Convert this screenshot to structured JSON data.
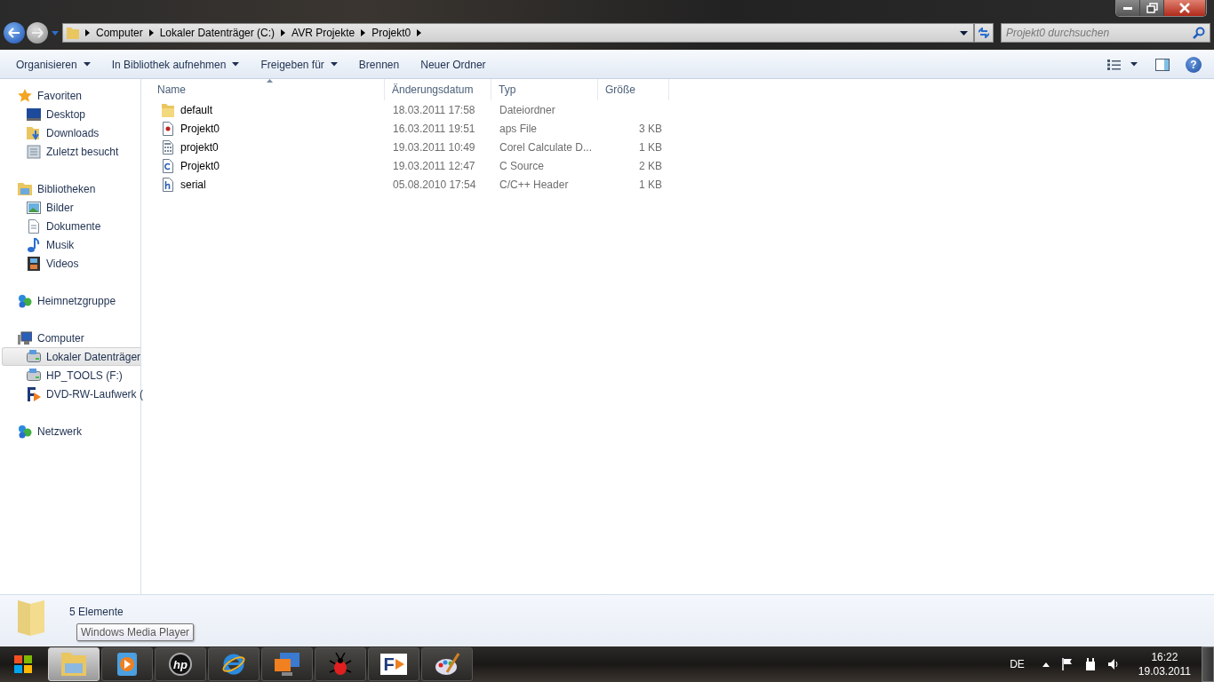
{
  "address_bar": {
    "crumbs": [
      "Computer",
      "Lokaler Datenträger (C:)",
      "AVR Projekte",
      "Projekt0"
    ]
  },
  "search": {
    "placeholder": "Projekt0 durchsuchen"
  },
  "toolbar": {
    "buttons": [
      {
        "label": "Organisieren",
        "dropdown": true
      },
      {
        "label": "In Bibliothek aufnehmen",
        "dropdown": true
      },
      {
        "label": "Freigeben für",
        "dropdown": true
      },
      {
        "label": "Brennen",
        "dropdown": false
      },
      {
        "label": "Neuer Ordner",
        "dropdown": false
      }
    ],
    "help": "?"
  },
  "sidebar": {
    "groups": [
      {
        "label": "Favoriten",
        "kind": "star",
        "children": [
          {
            "label": "Desktop",
            "kind": "desktop",
            "selected": false
          },
          {
            "label": "Downloads",
            "kind": "download",
            "selected": false
          },
          {
            "label": "Zuletzt besucht",
            "kind": "recent",
            "selected": false
          }
        ]
      },
      {
        "label": "Bibliotheken",
        "kind": "library",
        "children": [
          {
            "label": "Bilder",
            "kind": "picture",
            "selected": false
          },
          {
            "label": "Dokumente",
            "kind": "doc",
            "selected": false
          },
          {
            "label": "Musik",
            "kind": "music",
            "selected": false
          },
          {
            "label": "Videos",
            "kind": "film",
            "selected": false
          }
        ]
      },
      {
        "label": "Heimnetzgruppe",
        "kind": "network"
      },
      {
        "label": "Computer",
        "kind": "computer",
        "children": [
          {
            "label": "Lokaler Datenträger",
            "kind": "drive",
            "selected": true
          },
          {
            "label": "HP_TOOLS (F:)",
            "kind": "drive",
            "selected": false
          },
          {
            "label": "DVD-RW-Laufwerk (",
            "kind": "fdrive",
            "selected": false
          }
        ]
      },
      {
        "label": "Netzwerk",
        "kind": "network"
      }
    ]
  },
  "table": {
    "columns": [
      "Name",
      "Änderungsdatum",
      "Typ",
      "Größe"
    ],
    "rows": [
      {
        "kind": "folder",
        "name": "default",
        "date": "18.03.2011 17:58",
        "type": "Dateiordner",
        "size": ""
      },
      {
        "kind": "aps",
        "name": "Projekt0",
        "date": "16.03.2011 19:51",
        "type": "aps File",
        "size": "3 KB"
      },
      {
        "kind": "calc",
        "name": "projekt0",
        "date": "19.03.2011 10:49",
        "type": "Corel Calculate D...",
        "size": "1 KB"
      },
      {
        "kind": "c",
        "name": "Projekt0",
        "date": "19.03.2011 12:47",
        "type": "C Source",
        "size": "2 KB"
      },
      {
        "kind": "h",
        "name": "serial",
        "date": "05.08.2010 17:54",
        "type": "C/C++ Header",
        "size": "1 KB"
      }
    ]
  },
  "status_bar": {
    "count": "5 Elemente"
  },
  "tooltip": "Windows Media Player",
  "taskbar": {
    "items": [
      {
        "kind": "explorer",
        "selected": true
      },
      {
        "kind": "media",
        "selected": false
      },
      {
        "kind": "hp",
        "text": "hp",
        "selected": false
      },
      {
        "kind": "ie",
        "selected": false
      },
      {
        "kind": "monitor",
        "selected": false
      },
      {
        "kind": "bug",
        "selected": false
      },
      {
        "kind": "flowcode",
        "text": "F",
        "selected": false
      },
      {
        "kind": "paint",
        "selected": false
      }
    ],
    "language": "DE",
    "time": "16:22",
    "date": "19.03.2011"
  }
}
